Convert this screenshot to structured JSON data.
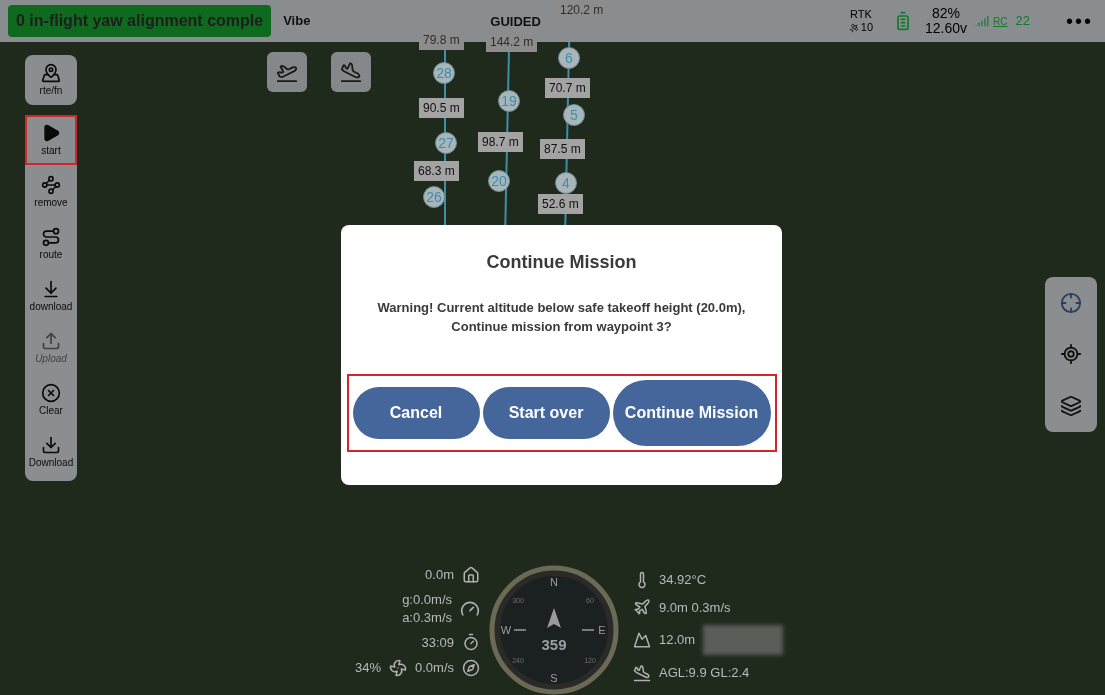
{
  "status_bar": {
    "message": "0 in-flight yaw alignment comple",
    "vehicle": "Vibe",
    "mode": "GUIDED",
    "gps": {
      "label": "RTK",
      "satellites": "10"
    },
    "battery": {
      "percent": "82%",
      "voltage": "12.60v"
    },
    "rc": {
      "label": "RC",
      "value": "22"
    },
    "menu": "•••"
  },
  "sidebar": {
    "top": {
      "kind": "route-find",
      "label": "rte/fn"
    },
    "items": [
      {
        "kind": "start",
        "label": "start",
        "highlighted": true,
        "disabled": false
      },
      {
        "kind": "remove",
        "label": "remove",
        "highlighted": false,
        "disabled": false
      },
      {
        "kind": "route",
        "label": "route",
        "highlighted": false,
        "disabled": false
      },
      {
        "kind": "download",
        "label": "download",
        "highlighted": false,
        "disabled": false
      },
      {
        "kind": "upload",
        "label": "Upload",
        "highlighted": false,
        "disabled": true
      },
      {
        "kind": "clear",
        "label": "Clear",
        "highlighted": false,
        "disabled": false
      },
      {
        "kind": "download-alt",
        "label": "Download",
        "highlighted": false,
        "disabled": false
      }
    ]
  },
  "waypoints": [
    "28",
    "27",
    "26",
    "19",
    "20",
    "6",
    "5",
    "4"
  ],
  "distances": [
    "120.2 m",
    "79.8 m",
    "144.2 m",
    "90.5 m",
    "70.7 m",
    "98.7 m",
    "87.5 m",
    "68.3 m",
    "52.6 m"
  ],
  "telemetry": {
    "home_distance": "0.0m",
    "ground_speed": "g:0.0m/s",
    "air_speed": "a:0.3m/s",
    "flight_time": "33:09",
    "throttle": "34%",
    "vertical_speed": "0.0m/s",
    "temperature": "34.92°C",
    "height_info": "9.0m 0.3m/s",
    "altitude": "12.0m",
    "agl": "AGL:9.9 GL:2.4"
  },
  "compass": {
    "heading": "359",
    "cardinals": [
      "N",
      "E",
      "S",
      "W"
    ],
    "ticks": [
      "300",
      "60",
      "240",
      "120"
    ]
  },
  "dialog": {
    "title": "Continue Mission",
    "message": "Warning! Current altitude below safe takeoff height (20.0m), Continue mission from waypoint 3?",
    "buttons": [
      "Cancel",
      "Start over",
      "Continue Mission"
    ],
    "buttons_highlighted": true
  }
}
